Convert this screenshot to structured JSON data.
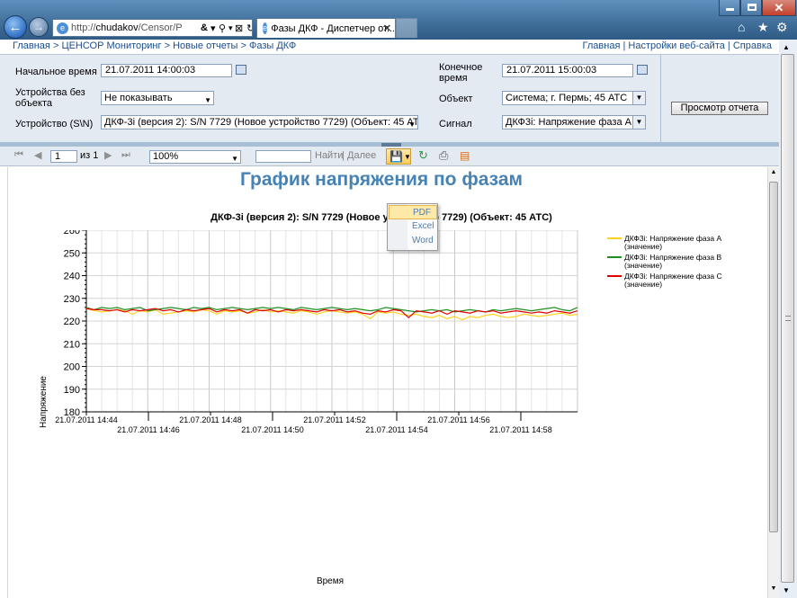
{
  "browser": {
    "address_prefix": "http://",
    "address_domain": "chudakov",
    "address_path": "/Censor/P",
    "active_tab_title": "Фазы ДКФ - Диспетчер от...",
    "nav_back_icon": "back-arrow-icon",
    "nav_forward_icon": "forward-arrow-icon"
  },
  "breadcrumb": {
    "items": [
      "Главная",
      "ЦЕНСОР Мониторинг",
      "Новые отчеты",
      "Фазы ДКФ"
    ],
    "separator": ">",
    "right_links": [
      "Главная",
      "Настройки веб-сайта",
      "Справка"
    ],
    "right_separator": "|"
  },
  "params": {
    "start_time_label": "Начальное время",
    "start_time_value": "21.07.2011 14:00:03",
    "end_time_label": "Конечное время",
    "end_time_value": "21.07.2011 15:00:03",
    "devices_label": "Устройства без объекта",
    "devices_value": "Не показывать",
    "object_label": "Объект",
    "object_value": "Система; г. Пермь; 45 АТС",
    "device_label": "Устройство (S\\N)",
    "device_value": "ДКФ-3i (версия 2):  S/N 7729 (Новое устройство 7729) (Объект: 45 АТС)",
    "signal_label": "Сигнал",
    "signal_value": "ДКФ3i: Напряжение фаза А (зн",
    "view_button": "Просмотр отчета"
  },
  "toolbar": {
    "page_value": "1",
    "page_of": "из 1",
    "zoom_value": "100%",
    "find_label": "Найти",
    "next_label": "Далее",
    "find_separator": "|"
  },
  "export_menu": {
    "items": [
      "PDF",
      "Excel",
      "Word"
    ],
    "selected": "PDF"
  },
  "report": {
    "title": "График напряжения по фазам"
  },
  "colors": {
    "phase_a": "#ffd21f",
    "phase_b": "#1f8f1f",
    "phase_c": "#e00000",
    "title": "#4682b4",
    "link": "#1d4e8a"
  },
  "chart_data": {
    "type": "line",
    "title": "ДКФ-3i (версия 2):  S/N 7729 (Новое устройство 7729) (Объект: 45 АТС)",
    "xlabel": "Время",
    "ylabel": "Напряжение",
    "ylim": [
      180,
      260
    ],
    "yticks": [
      "180",
      "190",
      "200",
      "210",
      "220",
      "230",
      "240",
      "250",
      "260"
    ],
    "xlim": [
      "21.07.2011 14:44",
      "21.07.2011 15:00"
    ],
    "xticks_upper": [
      "21.07.2011 14:44",
      "21.07.2011 14:48",
      "21.07.2011 14:52",
      "21.07.2011 14:56"
    ],
    "xticks_lower": [
      "21.07.2011 14:46",
      "21.07.2011 14:50",
      "21.07.2011 14:54",
      "21.07.2011 14:58"
    ],
    "grid": true,
    "legend_position": "right",
    "series": [
      {
        "name": "ДКФ3i: Напряжение фаза А",
        "name_suffix": "(значение)",
        "values": [
          225.5,
          224.5,
          224,
          224.5,
          225,
          224.5,
          223,
          224.5,
          224,
          225,
          223,
          223.5,
          224,
          224.5,
          224,
          225,
          224.5,
          223,
          224.5,
          224,
          224.5,
          223.5,
          224,
          225,
          224,
          224.5,
          224,
          223.5,
          224.5,
          224,
          223,
          224,
          224.5,
          224,
          223.5,
          224,
          223,
          221,
          224,
          223.5,
          224,
          223,
          222.5,
          223,
          222,
          221.5,
          222.5,
          221,
          222,
          220.5,
          222,
          221.5,
          222.5,
          223,
          222,
          221.5,
          222,
          223,
          222.5,
          222,
          222.5,
          223,
          223.5,
          222.5,
          223
        ]
      },
      {
        "name": "ДКФ3i: Напряжение фаза В",
        "name_suffix": "(значение)",
        "values": [
          226,
          225,
          226,
          225.5,
          226,
          225,
          225.5,
          226,
          224.5,
          225,
          225.5,
          226,
          225.5,
          225,
          226,
          225.5,
          226,
          225,
          225.5,
          226,
          225.5,
          225,
          225.5,
          226,
          225.5,
          226,
          225.5,
          225,
          226,
          225.5,
          225,
          225.5,
          226,
          225.5,
          225,
          225.5,
          225,
          224.5,
          225,
          226,
          225.5,
          225,
          224.5,
          224,
          224.5,
          225,
          224.5,
          225,
          224,
          224.5,
          225,
          224.5,
          224,
          225,
          224.5,
          225,
          225.5,
          225,
          224.5,
          225,
          225.5,
          226,
          225,
          224.5,
          226
        ]
      },
      {
        "name": "ДКФ3i: Напряжение фаза С",
        "name_suffix": "(значение)",
        "values": [
          225.5,
          225,
          225,
          224.5,
          225,
          224,
          225,
          224.5,
          225,
          225.5,
          224.5,
          225,
          224,
          225,
          224.5,
          225,
          225.5,
          224,
          225,
          224.5,
          225,
          223.5,
          225,
          224.5,
          225,
          224,
          225,
          224.5,
          225,
          224.5,
          224,
          225,
          224.5,
          225,
          224,
          224.5,
          223.5,
          223,
          224.5,
          224,
          225,
          224.5,
          221.5,
          224.5,
          224,
          223.5,
          224.5,
          223,
          224.5,
          224,
          223.5,
          224.5,
          224,
          224.5,
          223.5,
          224,
          224.5,
          224,
          223.5,
          224,
          223.5,
          224.5,
          224,
          223.5,
          224.5
        ]
      }
    ]
  }
}
